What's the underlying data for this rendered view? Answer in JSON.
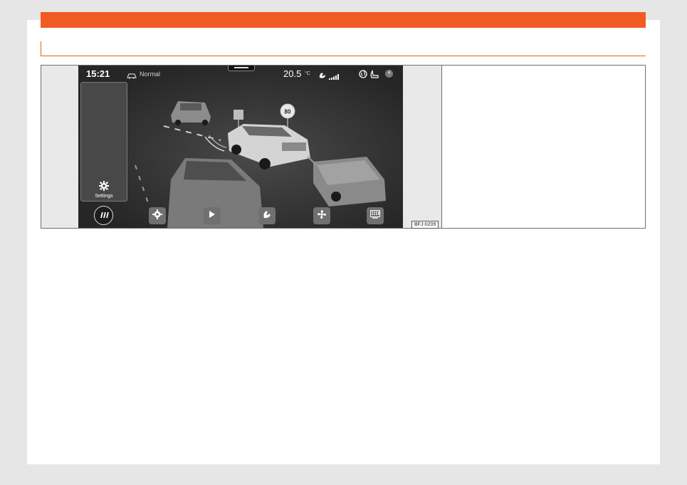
{
  "figure": {
    "code": "BFJ-0209"
  },
  "status_bar": {
    "time": "15:21",
    "drive_mode": "Normal",
    "temperature": "20.5",
    "temperature_unit": "°C",
    "badge": "4"
  },
  "side_panel": {
    "settings_label": "Settings"
  },
  "scene": {
    "speed_sign": "80"
  },
  "dock": {
    "items": [
      "menu-icon",
      "settings-icon",
      "play-icon",
      "phone-icon",
      "fan-icon",
      "phone-mirror-icon"
    ]
  },
  "colors": {
    "accent": "#f15a22",
    "screen_background": "#2e2e2e"
  }
}
